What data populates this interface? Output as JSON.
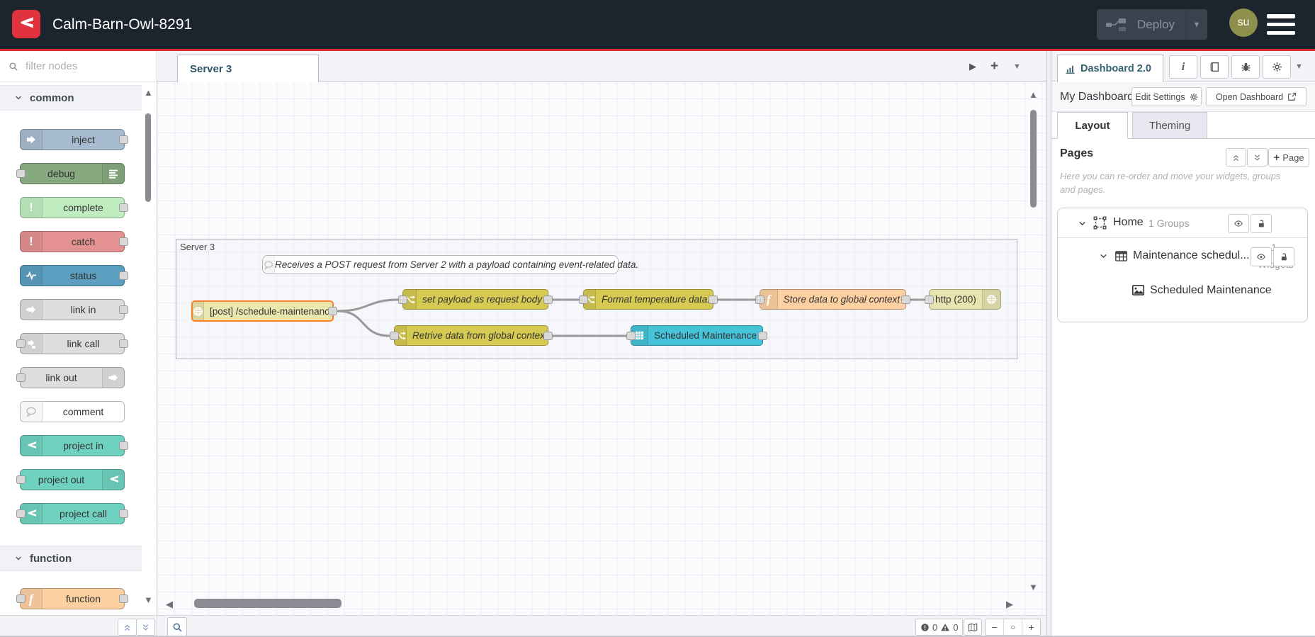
{
  "header": {
    "title": "Calm-Barn-Owl-8291",
    "deploy_label": "Deploy",
    "avatar_initials": "su"
  },
  "palette": {
    "filter_placeholder": "filter nodes",
    "categories": [
      {
        "label": "common",
        "nodes": [
          {
            "label": "inject",
            "color": "#a6bbcf"
          },
          {
            "label": "debug",
            "color": "#87a980"
          },
          {
            "label": "complete",
            "color": "#c0edc0"
          },
          {
            "label": "catch",
            "color": "#e49191"
          },
          {
            "label": "status",
            "color": "#5b9ebf"
          },
          {
            "label": "link in",
            "color": "#dddddd"
          },
          {
            "label": "link call",
            "color": "#dddddd"
          },
          {
            "label": "link out",
            "color": "#dddddd"
          },
          {
            "label": "comment",
            "color": "#ffffff"
          },
          {
            "label": "project in",
            "color": "#6fd1bf"
          },
          {
            "label": "project out",
            "color": "#6fd1bf"
          },
          {
            "label": "project call",
            "color": "#6fd1bf"
          }
        ]
      },
      {
        "label": "function",
        "nodes": [
          {
            "label": "function",
            "color": "#fdd0a2"
          }
        ]
      }
    ]
  },
  "flow": {
    "tab_label": "Server 3",
    "group_label": "Server 3",
    "comment": "Receives a POST request from Server 2 with a payload containing event-related data.",
    "nodes": [
      {
        "label": "[post] /schedule-maintenance",
        "type": "http in",
        "color": "#ece7ae",
        "selected": true
      },
      {
        "label": "set payload as request body",
        "type": "change",
        "color": "#d6ca52"
      },
      {
        "label": "Format temperature data.",
        "type": "change",
        "color": "#d6ca52"
      },
      {
        "label": "Store data to global context",
        "type": "function",
        "color": "#fdd0a2"
      },
      {
        "label": "http (200)",
        "type": "http response",
        "color": "#e8e4b0"
      },
      {
        "label": "Retrive data from global context",
        "type": "change",
        "color": "#d6ca52"
      },
      {
        "label": "Scheduled Maintenance",
        "type": "ui-table",
        "color": "#45c3d9"
      }
    ]
  },
  "sidebar": {
    "tab_label": "Dashboard 2.0",
    "dashboard_name": "My Dashboard",
    "edit_settings_label": "Edit Settings",
    "open_dashboard_label": "Open Dashboard",
    "tabs": {
      "layout": "Layout",
      "theming": "Theming"
    },
    "pages": {
      "title": "Pages",
      "add_label": "Page",
      "help": "Here you can re-order and move your widgets, groups and pages."
    },
    "tree": {
      "page_name": "Home",
      "page_meta": "1 Groups",
      "group_name": "Maintenance schedul...",
      "group_meta_count": "1",
      "group_meta_word": "Widgets",
      "widget_name": "Scheduled Maintenance"
    }
  },
  "footer": {
    "error_count": "0",
    "warning_count": "0"
  },
  "colors": {
    "header_bg": "#1c242e",
    "accent_red": "#dd2c35",
    "brand_red": "#e1333e",
    "selected_node_border": "#ff7f23",
    "wire": "#999999",
    "avatar_bg": "#8e8e4d"
  },
  "icons": {
    "node-red-logo": "red square with white angled chevron",
    "deploy-icon": "two nodes joined by wire",
    "hamburger-icon": "three bars",
    "search-icon": "magnifier",
    "chart-icon": "bar chart",
    "info-icon": "italic i",
    "book-icon": "book",
    "bug-icon": "bug",
    "gear-icon": "gear",
    "eye-icon": "eye",
    "unlock-icon": "open padlock",
    "page-icon": "dashed selection square",
    "group-icon": "table grid",
    "widget-icon": "picture",
    "map-icon": "folded map",
    "error-icon": "circled exclamation",
    "warning-icon": "triangle exclamation"
  }
}
